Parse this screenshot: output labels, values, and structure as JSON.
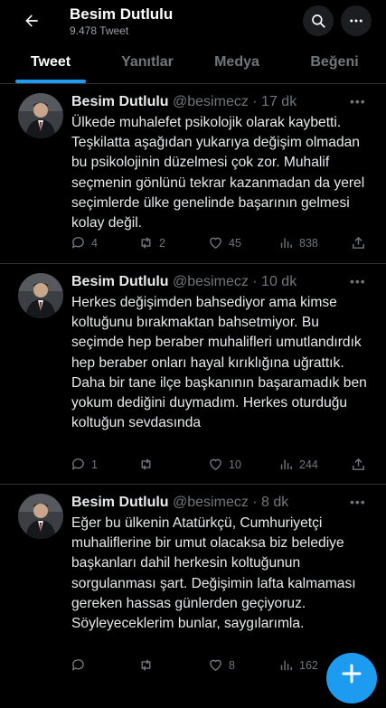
{
  "header": {
    "name": "Besim Dutlulu",
    "tweet_count": "9.478 Tweet"
  },
  "tabs": [
    {
      "label": "Tweet"
    },
    {
      "label": "Yanıtlar"
    },
    {
      "label": "Medya"
    },
    {
      "label": "Beğeni"
    }
  ],
  "tweets": [
    {
      "name": "Besim Dutlulu",
      "handle_time": "@besimecz · 17 dk",
      "text": "Ülkede muhalefet psikolojik olarak kaybetti. Teşkilatta aşağıdan yukarıya değişim olmadan bu psikolojinin düzelmesi çok zor. Muhalif seçmenin gönlünü tekrar kazanmadan da yerel seçimlerde ülke genelinde başarının gelmesi kolay değil.",
      "replies": "4",
      "retweets": "2",
      "likes": "45",
      "views": "838"
    },
    {
      "name": "Besim Dutlulu",
      "handle_time": "@besimecz · 10 dk",
      "text": "Herkes değişimden bahsediyor ama kimse koltuğunu bırakmaktan bahsetmiyor. Bu seçimde hep beraber muhalifleri umutlandırdık hep beraber onları hayal kırıklığına uğrattık. Daha bir tane ilçe başkanının başaramadık ben yokum dediğini duymadım. Herkes oturduğu koltuğun sevdasında",
      "replies": "1",
      "retweets": "",
      "likes": "10",
      "views": "244"
    },
    {
      "name": "Besim Dutlulu",
      "handle_time": "@besimecz · 8 dk",
      "text": "Eğer bu ülkenin Atatürkçü, Cumhuriyetçi muhaliflerine bir umut olacaksa biz belediye başkanları dahil herkesin koltuğunun sorgulanması şart. Değişimin lafta kalmaması gereken hassas günlerden geçiyoruz. Söyleyeceklerim bunlar, saygılarımla.",
      "replies": "",
      "retweets": "",
      "likes": "8",
      "views": "162"
    }
  ],
  "colors": {
    "accent": "#1d9bf0",
    "background": "#000000",
    "muted": "#71767b",
    "text": "#e7e9ea"
  }
}
